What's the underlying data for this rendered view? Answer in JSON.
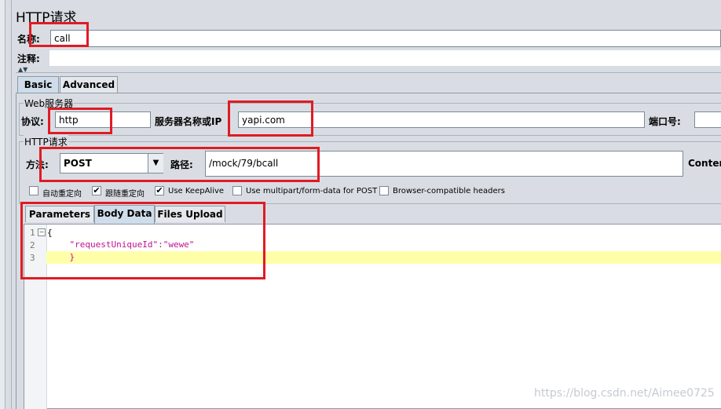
{
  "header": {
    "title": "HTTP请求"
  },
  "name_field": {
    "label": "名称:",
    "value": "call"
  },
  "comment_field": {
    "label": "注释:"
  },
  "tabs": [
    "Basic",
    "Advanced"
  ],
  "web_server": {
    "section_title": "Web服务器",
    "protocol_label": "协议:",
    "protocol_value": "http",
    "server_label": "服务器名称或IP",
    "server_value": "yapi.com",
    "port_label": "端口号:"
  },
  "http_request": {
    "section_title": "HTTP请求",
    "method_label": "方法:",
    "method_value": "POST",
    "path_label": "路径:",
    "path_value": "/mock/79/bcall",
    "content_label": "Content"
  },
  "options": [
    {
      "label": "自动重定向",
      "checked": false
    },
    {
      "label": "跟随重定向",
      "checked": true
    },
    {
      "label": "Use KeepAlive",
      "checked": true
    },
    {
      "label": "Use multipart/form-data for POST",
      "checked": false
    },
    {
      "label": "Browser-compatible headers",
      "checked": false
    }
  ],
  "body_tabs": [
    "Parameters",
    "Body Data",
    "Files Upload"
  ],
  "editor": {
    "line_numbers": [
      "1",
      "2",
      "3"
    ],
    "lines": [
      "{",
      "    \"requestUniqueId\":\"wewe\"",
      "    }"
    ]
  },
  "watermark": "https://blog.csdn.net/Aimee0725",
  "colors": {
    "highlight_line": "#ffffaa",
    "annotation_box": "#e01b24",
    "json_string": "#c0118f"
  }
}
